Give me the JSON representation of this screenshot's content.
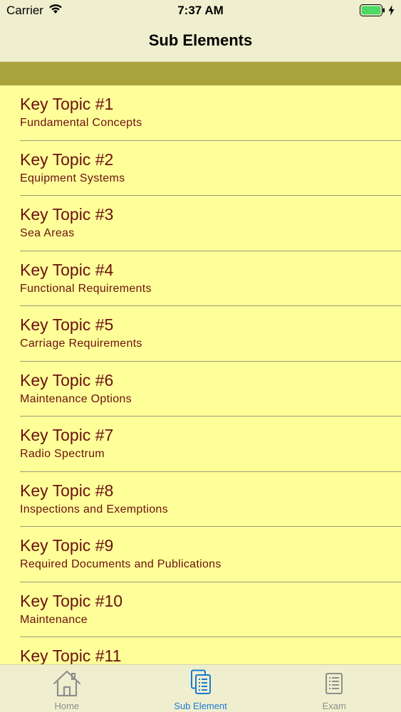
{
  "status": {
    "carrier": "Carrier",
    "time": "7:37 AM"
  },
  "nav": {
    "title": "Sub Elements"
  },
  "list": {
    "items": [
      {
        "title": "Key Topic #1",
        "subtitle": "Fundamental Concepts"
      },
      {
        "title": "Key Topic #2",
        "subtitle": "Equipment Systems"
      },
      {
        "title": "Key Topic #3",
        "subtitle": "Sea Areas"
      },
      {
        "title": "Key Topic #4",
        "subtitle": "Functional Requirements"
      },
      {
        "title": "Key Topic #5",
        "subtitle": "Carriage Requirements"
      },
      {
        "title": "Key Topic #6",
        "subtitle": "Maintenance Options"
      },
      {
        "title": "Key Topic #7",
        "subtitle": "Radio Spectrum"
      },
      {
        "title": "Key Topic #8",
        "subtitle": "Inspections and Exemptions"
      },
      {
        "title": "Key Topic #9",
        "subtitle": "Required Documents and Publications"
      },
      {
        "title": "Key Topic #10",
        "subtitle": "Maintenance"
      },
      {
        "title": "Key Topic #11",
        "subtitle": ""
      }
    ]
  },
  "tabs": {
    "home": {
      "label": "Home",
      "icon": "house-icon"
    },
    "sub_element": {
      "label": "Sub Element",
      "icon": "documents-icon"
    },
    "exam": {
      "label": "Exam",
      "icon": "list-document-icon"
    }
  },
  "colors": {
    "background": "#ffff99",
    "band": "#a9a43c",
    "text": "#6b1010",
    "active_tab": "#1a7ad6",
    "inactive_tab": "#8e8e8e"
  }
}
